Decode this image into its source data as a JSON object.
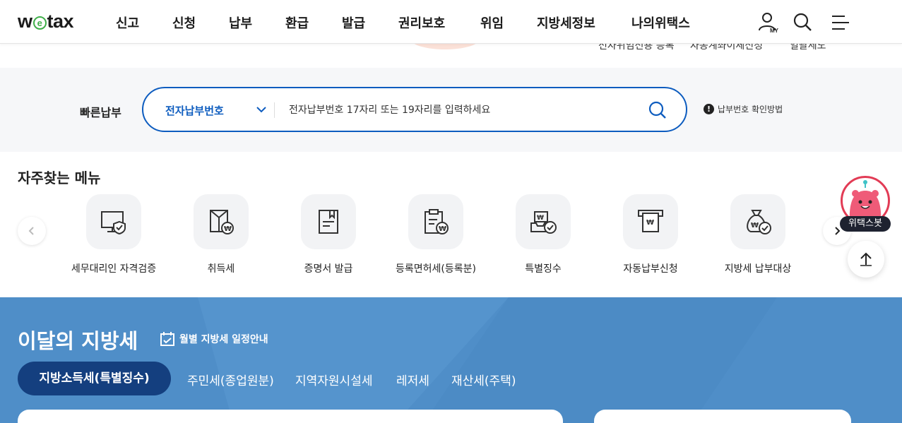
{
  "header": {
    "logo": "wetax",
    "nav": [
      "신고",
      "신청",
      "납부",
      "환급",
      "발급",
      "권리보호",
      "위임",
      "지방세정보",
      "나의위택스"
    ],
    "my_label": "MY"
  },
  "strip": {
    "cut_texts": [
      "전자위임전용 등록",
      "자동계좌이체신청",
      "일괄세도"
    ]
  },
  "quick_pay": {
    "label": "빠른납부",
    "select_value": "전자납부번호",
    "input_placeholder": "전자납부번호 17자리 또는 19자리를 입력하세요",
    "help_text": "납부번호 확인방법"
  },
  "favorites": {
    "title": "자주찾는 메뉴",
    "items": [
      {
        "label": "세무대리인 자격검증",
        "icon": "monitor-shield-icon"
      },
      {
        "label": "취득세",
        "icon": "envelope-won-icon"
      },
      {
        "label": "증명서 발급",
        "icon": "document-bookmark-icon"
      },
      {
        "label": "등록면허세(등록분)",
        "icon": "clipboard-won-icon"
      },
      {
        "label": "특별징수",
        "icon": "tray-check-icon"
      },
      {
        "label": "자동납부신청",
        "icon": "atm-receipt-icon"
      },
      {
        "label": "지방세 납부대상",
        "icon": "money-bag-check-icon"
      }
    ]
  },
  "chatbot": {
    "label": "위택스봇"
  },
  "monthly": {
    "title": "이달의 지방세",
    "calendar_label": "월별 지방세 일정안내",
    "tabs": [
      "지방소득세(특별징수)",
      "주민세(종업원분)",
      "지역자원시설세",
      "레저세",
      "재산세(주택)"
    ],
    "active_tab": 0
  },
  "colors": {
    "brand_blue": "#0d5cbf",
    "monthly_bg": "#4f8ec8",
    "active_tab_bg": "#143f7f",
    "chatbot_red": "#e23b55"
  }
}
